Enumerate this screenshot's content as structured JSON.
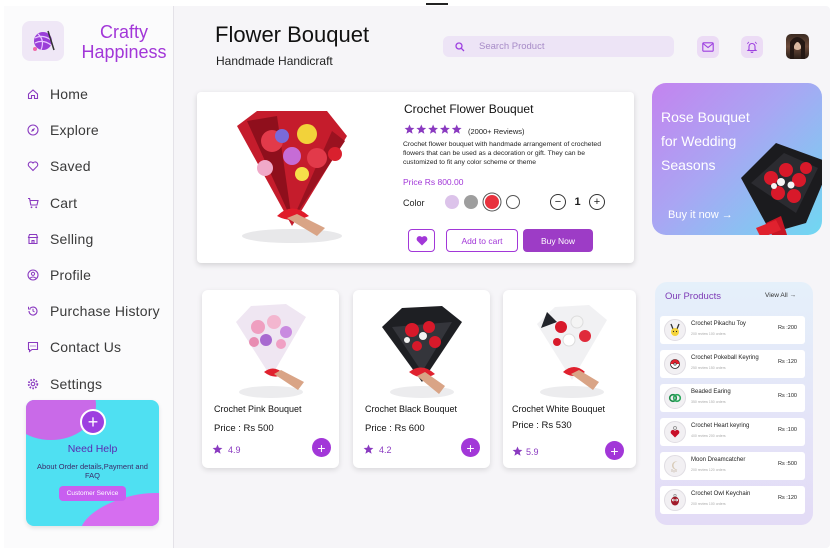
{
  "brand": {
    "name_line1": "Crafty",
    "name_line2": "Happiness",
    "accent": "#a237d8"
  },
  "sidebar": {
    "items": [
      {
        "label": "Home",
        "icon": "home-icon"
      },
      {
        "label": "Explore",
        "icon": "compass-icon"
      },
      {
        "label": "Saved",
        "icon": "heart-icon"
      },
      {
        "label": "Cart",
        "icon": "cart-icon"
      },
      {
        "label": "Selling",
        "icon": "shop-icon"
      },
      {
        "label": "Profile",
        "icon": "user-icon"
      },
      {
        "label": "Purchase History",
        "icon": "history-icon"
      },
      {
        "label": "Contact Us",
        "icon": "chat-icon"
      },
      {
        "label": "Settings",
        "icon": "gear-icon"
      }
    ],
    "help": {
      "title": "Need Help",
      "description": "About Order details,Payment and FAQ",
      "button": "Customer Service"
    }
  },
  "header": {
    "title": "Flower Bouquet",
    "subtitle": "Handmade Handicraft",
    "search_placeholder": "Search Product"
  },
  "featured": {
    "name": "Crochet Flower Bouquet",
    "rating_stars": 5,
    "reviews": "(2000+ Reviews)",
    "description": "Crochet flower bouquet with handmade arrangement of crocheted flowers that can be used as a decoration or gift. They can be customized to fit any color scheme or theme",
    "price": "Price Rs 800.00",
    "color_label": "Color",
    "colors": [
      "#dcc3ea",
      "#9e9e9e",
      "#e8323e",
      "#ffffff"
    ],
    "selected_color_index": 2,
    "quantity": "1",
    "add_to_cart": "Add to cart",
    "buy_now": "Buy Now"
  },
  "promo": {
    "title": "Rose Bouquet for Wedding Seasons",
    "link": "Buy it now →"
  },
  "products": [
    {
      "name": "Crochet Pink Bouquet",
      "price": "Price : Rs 500",
      "rating": "4.9"
    },
    {
      "name": "Crochet Black Bouquet",
      "price": "Price : Rs 600",
      "rating": "4.2"
    },
    {
      "name": "Crochet White Bouquet",
      "price": "Price : Rs 530",
      "rating": "5.9"
    }
  ],
  "our_products": {
    "title": "Our Products",
    "view_all": "View All →",
    "items": [
      {
        "name": "Crochet Pikachu Toy",
        "meta": "200 review  100 orders",
        "price": "Rs :200"
      },
      {
        "name": "Crochet Pokeball Keyring",
        "meta": "250 review  150 orders",
        "price": "Rs :120"
      },
      {
        "name": "Beaded Earing",
        "meta": "350 review  150 orders",
        "price": "Rs :100"
      },
      {
        "name": "Crochet Heart keyring",
        "meta": "400 review  200 orders",
        "price": "Rs :100"
      },
      {
        "name": "Moon Dreamcatcher",
        "meta": "200 review  120 orders",
        "price": "Rs :500"
      },
      {
        "name": "Crochet Owl Keychain",
        "meta": "200 review  100 orders",
        "price": "Rs :120"
      }
    ]
  }
}
